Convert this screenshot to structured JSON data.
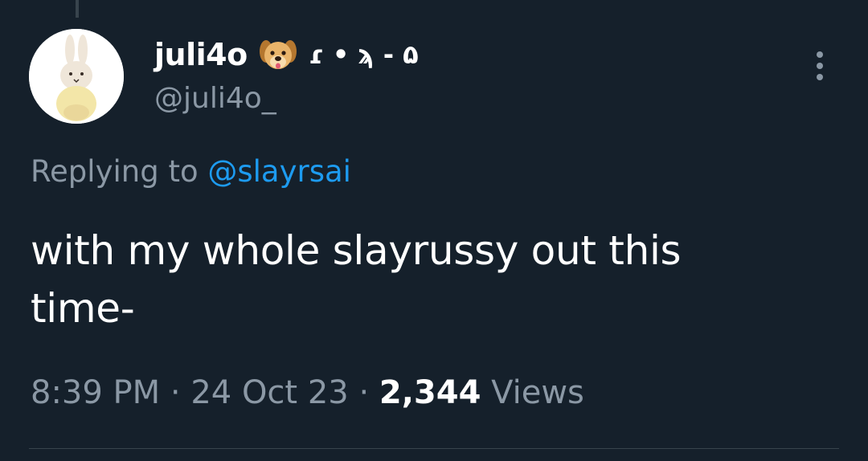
{
  "tweet": {
    "display_name": "juli4o",
    "name_emoji": "dog-face-emoji",
    "name_decoration": "ɾ • ϡ - ۵",
    "handle": "@juli4o_",
    "replying_prefix": "Replying to",
    "replying_to": "@slayrsai",
    "text_line1": "with my whole slayrussy out this",
    "text_line2": "time-",
    "time": "8:39 PM",
    "separator": "·",
    "date": "24 Oct 23",
    "views_count": "2,344",
    "views_label": "Views"
  },
  "icons": {
    "more": "more-options-icon",
    "avatar": "bunny-avatar"
  },
  "colors": {
    "background": "#15202b",
    "primary_text": "#ffffff",
    "secondary_text": "#8b98a5",
    "link": "#1d9bf0",
    "divider": "#38444d"
  }
}
